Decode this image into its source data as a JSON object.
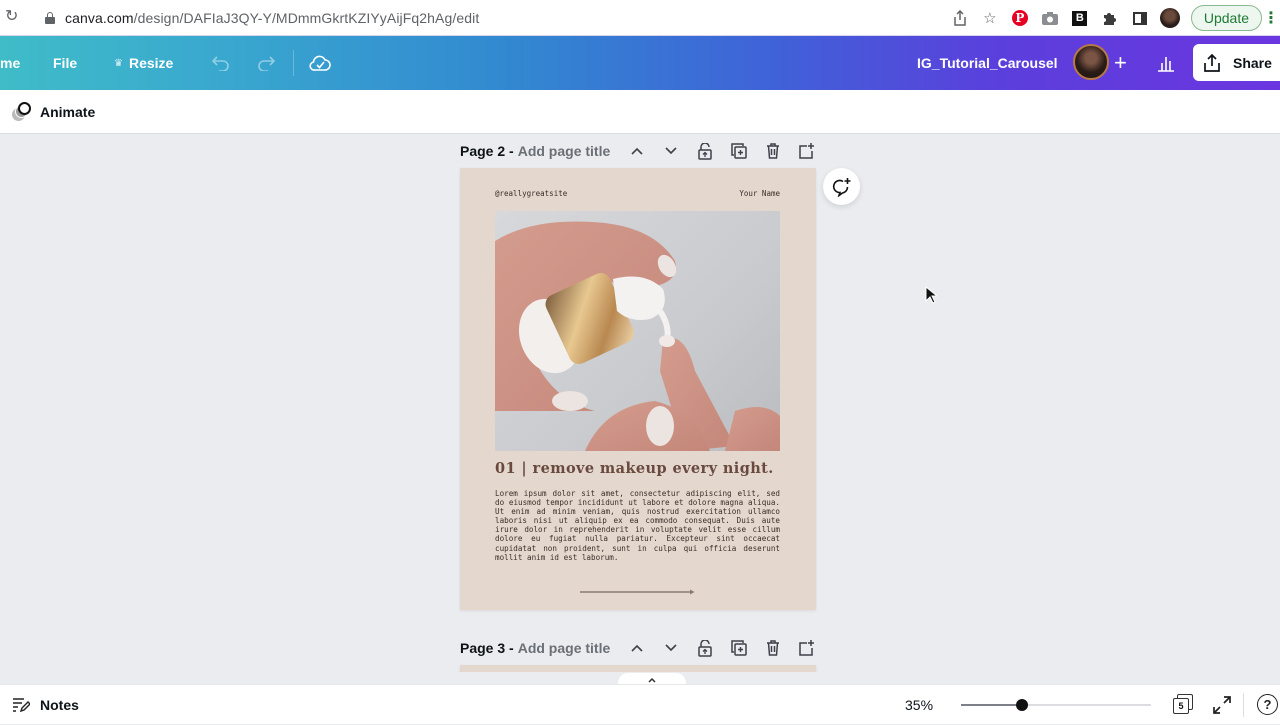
{
  "browser": {
    "url_host": "canva.com",
    "url_path": "/design/DAFIaJ3QY-Y/MDmmGkrtKZIYyAijFq2hAg/edit",
    "update_label": "Update",
    "icons": [
      "share-icon",
      "bookmark-star-icon",
      "pinterest-extension-icon",
      "camera-extension-icon",
      "b-extension-icon",
      "extensions-puzzle-icon",
      "side-panel-icon",
      "profile-avatar"
    ]
  },
  "topbar": {
    "home_label": "me",
    "file_label": "File",
    "resize_label": "Resize",
    "resize_icon": "crown-icon",
    "doc_title": "IG_Tutorial_Carousel",
    "plus_label": "+",
    "share_label": "Share",
    "brand_gradient": [
      "#3fbcc8",
      "#3288d0",
      "#6a36df"
    ]
  },
  "subbar": {
    "animate_label": "Animate"
  },
  "pages": [
    {
      "number_label": "Page 2 -",
      "title_placeholder": "Add page title",
      "content": {
        "handle": "@reallygreatsite",
        "name": "Your Name",
        "heading": "01 | remove makeup every night.",
        "body": "Lorem ipsum dolor sit amet, consectetur adipiscing elit, sed do eiusmod tempor incididunt ut labore et dolore magna aliqua. Ut enim ad minim veniam, quis nostrud exercitation ullamco laboris nisi ut aliquip ex ea commodo consequat. Duis aute irure dolor in reprehenderit in voluptate velit esse cillum dolore eu fugiat nulla pariatur. Excepteur sint occaecat cupidatat non proident, sunt in culpa qui officia deserunt mollit anim id est laborum.",
        "background": "#e4d7ce",
        "heading_color": "#6a4a3f"
      }
    },
    {
      "number_label": "Page 3 -",
      "title_placeholder": "Add page title"
    }
  ],
  "bottombar": {
    "notes_label": "Notes",
    "zoom_label": "35%",
    "zoom_fraction": 0.32,
    "page_count": "5",
    "help_label": "?"
  }
}
